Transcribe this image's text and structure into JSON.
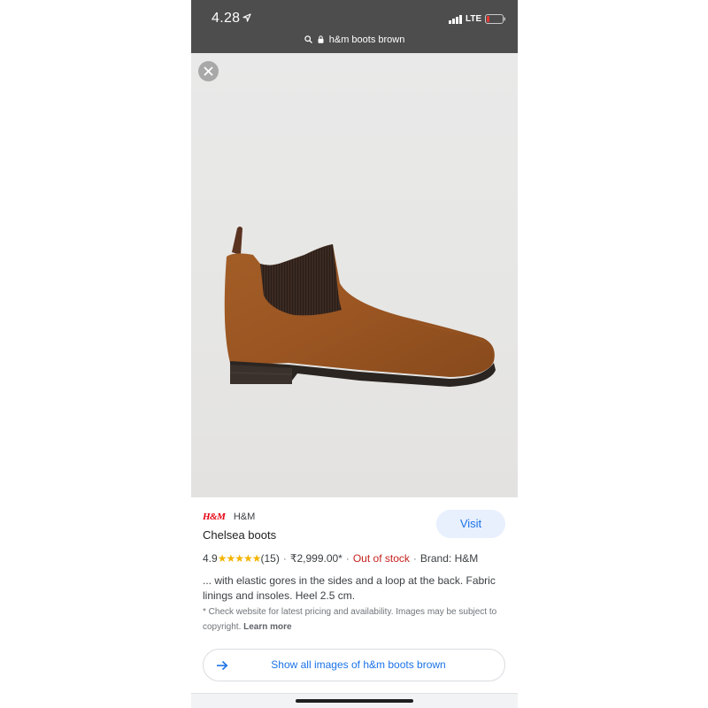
{
  "status_bar": {
    "time": "4.28",
    "network": "LTE",
    "colors": {
      "background": "#4d4d4d",
      "battery_low": "#e53935"
    }
  },
  "address_bar": {
    "url": "h&m boots brown",
    "icons": [
      "search-icon",
      "lock-icon"
    ]
  },
  "image_viewer": {
    "close_icon": "close-icon",
    "image_subject": "brown suede chelsea boot"
  },
  "product": {
    "brand_logo": "H&M",
    "brand_name": "H&M",
    "title": "Chelsea boots",
    "visit_label": "Visit",
    "rating": "4.9",
    "stars": "★★★★★",
    "reviews": "(15)",
    "price": "₹2,999.00*",
    "availability": "Out of stock",
    "brand_info": "Brand: H&M",
    "separator": "·",
    "description": "... with elastic gores in the sides and a loop at the back. Fabric linings and insoles. Heel 2.5 cm.",
    "disclaimer": "* Check website for latest pricing and availability. Images may be subject to copyright.",
    "learn_more": "Learn more",
    "colors": {
      "link": "#1a73e8",
      "out_of_stock": "#c5221f",
      "stars": "#f4b400",
      "brand_red": "#e50010"
    }
  },
  "show_all": {
    "label": "Show all images of h&m boots brown",
    "icon": "arrow-right-icon"
  }
}
